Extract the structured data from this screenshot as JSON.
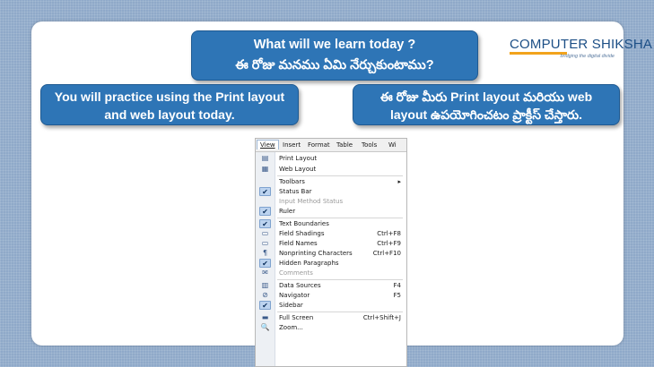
{
  "title_bubble": {
    "line1": "What will we learn today ?",
    "line2": "ఈ రోజు మనము ఏమి నేర్చుకుంటాము?"
  },
  "logo": {
    "text": "COMPUTER SHIKSHA",
    "tagline": "bridging the digital divide"
  },
  "left_bubble": {
    "line1": "You will practice using the Print layout",
    "line2": "and web layout today."
  },
  "right_bubble": {
    "line1": "ఈ రోజు మీరు Print layout మరియు web",
    "line2": "layout ఉపయోగించటం ప్రాక్టీస్ చేస్తారు."
  },
  "menubar": [
    "View",
    "Insert",
    "Format",
    "Table",
    "Tools",
    "Wi"
  ],
  "menu_items": [
    {
      "label": "Print Layout",
      "icon": "print-layout-icon",
      "shortcut": ""
    },
    {
      "label": "Web Layout",
      "icon": "web-layout-icon",
      "shortcut": ""
    },
    {
      "label": "Toolbars",
      "icon": "",
      "shortcut": "▸"
    },
    {
      "label": "Status Bar",
      "icon": "check-icon",
      "shortcut": ""
    },
    {
      "label": "Input Method Status",
      "icon": "",
      "shortcut": "",
      "disabled": true
    },
    {
      "label": "Ruler",
      "icon": "check-icon",
      "shortcut": ""
    },
    {
      "label": "Text Boundaries",
      "icon": "check-icon",
      "shortcut": ""
    },
    {
      "label": "Field Shadings",
      "icon": "field-shadings-icon",
      "shortcut": "Ctrl+F8"
    },
    {
      "label": "Field Names",
      "icon": "field-names-icon",
      "shortcut": "Ctrl+F9"
    },
    {
      "label": "Nonprinting Characters",
      "icon": "pilcrow-icon",
      "shortcut": "Ctrl+F10"
    },
    {
      "label": "Hidden Paragraphs",
      "icon": "check-icon",
      "shortcut": ""
    },
    {
      "label": "Comments",
      "icon": "comments-icon",
      "shortcut": "",
      "disabled": true
    },
    {
      "label": "Data Sources",
      "icon": "data-sources-icon",
      "shortcut": "F4"
    },
    {
      "label": "Navigator",
      "icon": "navigator-icon",
      "shortcut": "F5"
    },
    {
      "label": "Sidebar",
      "icon": "check-icon",
      "shortcut": ""
    },
    {
      "label": "Full Screen",
      "icon": "full-screen-icon",
      "shortcut": "Ctrl+Shift+J"
    },
    {
      "label": "Zoom...",
      "icon": "zoom-icon",
      "shortcut": ""
    }
  ],
  "colors": {
    "bubble": "#2e75b6",
    "background": "#8fa9c9",
    "logo_accent": "#f2a31b"
  }
}
